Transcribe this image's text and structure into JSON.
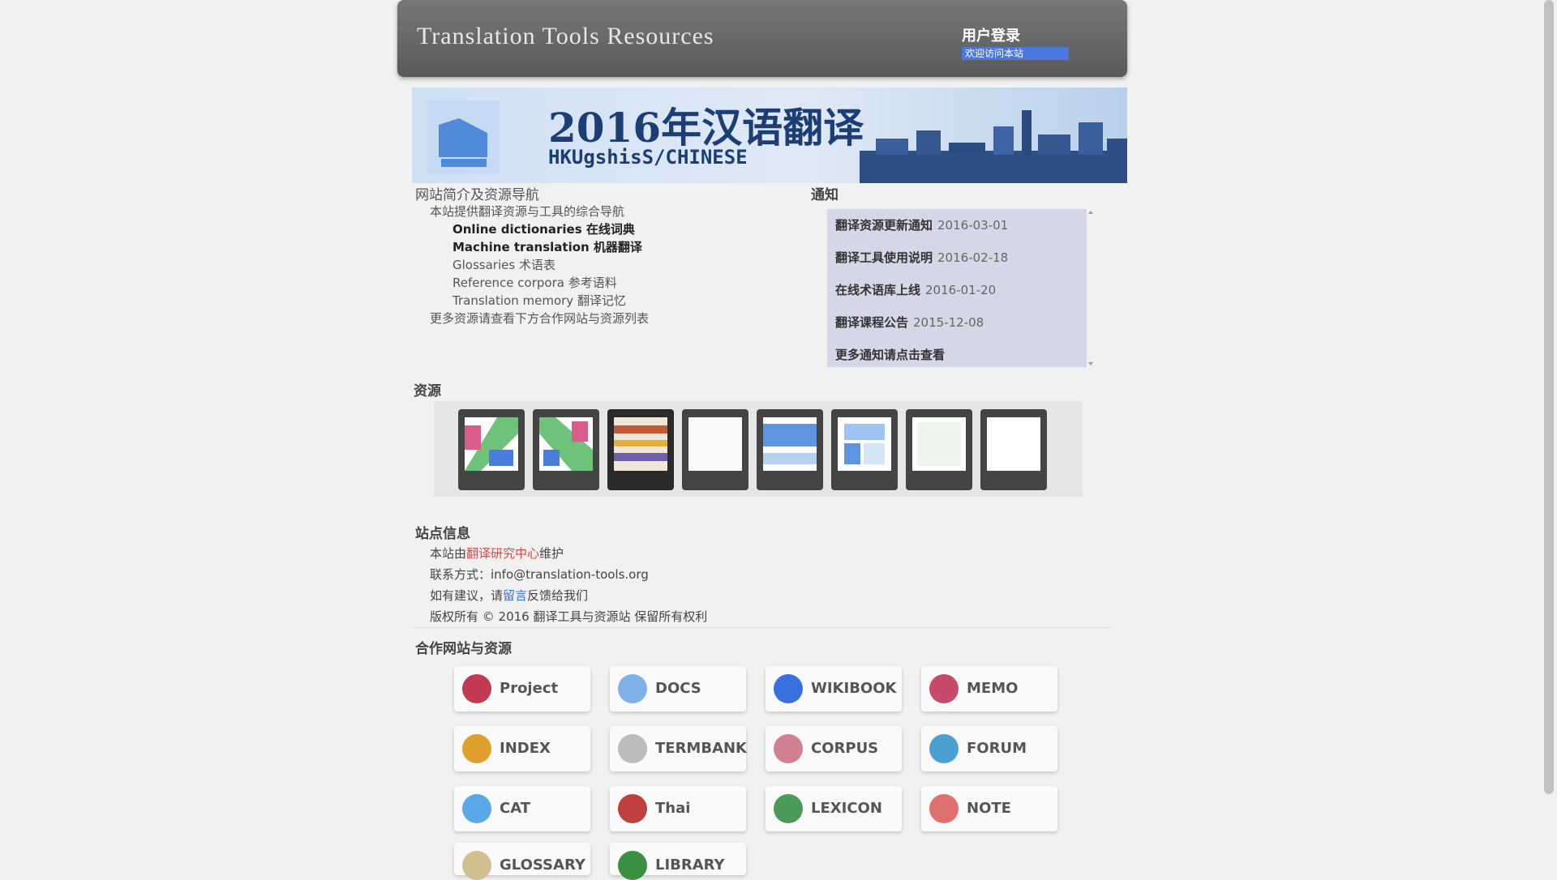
{
  "header": {
    "title": "Translation Tools Resources",
    "login_label": "用户登录",
    "login_sub": "欢迎访问本站"
  },
  "banner": {
    "title": "2016年汉语翻译",
    "subtitle": "HKUgshisS/CHINESE"
  },
  "intro": {
    "heading": "网站简介及资源导航",
    "lines": [
      "本站提供翻译资源与工具的综合导航",
      "Online dictionaries 在线词典",
      "Machine translation 机器翻译",
      "Glossaries 术语表",
      "Reference corpora 参考语料",
      "Translation memory 翻译记忆",
      "更多资源请查看下方合作网站与资源列表"
    ]
  },
  "notice": {
    "heading": "通知",
    "items": [
      {
        "title": "翻译资源更新通知",
        "date": "2016-03-01"
      },
      {
        "title": "翻译工具使用说明",
        "date": "2016-02-18"
      },
      {
        "title": "在线术语库上线",
        "date": "2016-01-20"
      },
      {
        "title": "翻译课程公告",
        "date": "2015-12-08"
      },
      {
        "title": "更多通知请点击查看",
        "date": ""
      }
    ]
  },
  "carousel": {
    "heading": "资源"
  },
  "info": {
    "heading": "站点信息",
    "lines": [
      {
        "pre": "本站由",
        "highlight": "翻译研究中心",
        "post": "维护"
      },
      {
        "pre": "联系方式：info@translation-tools.org",
        "highlight": "",
        "post": ""
      },
      {
        "pre": "如有建议，请",
        "highlight": "留言",
        "post": "反馈给我们"
      },
      {
        "pre": "版权所有 © 2016 翻译工具与资源站 保留所有权利",
        "highlight": "",
        "post": ""
      }
    ]
  },
  "partners": {
    "heading": "合作网站与资源",
    "items": [
      {
        "name": "Project",
        "color": "#c23a52"
      },
      {
        "name": "DOCS",
        "color": "#7fb0e8"
      },
      {
        "name": "WIKIBOOK",
        "color": "#3a6fe0"
      },
      {
        "name": "MEMO",
        "color": "#c84a6a"
      },
      {
        "name": "INDEX",
        "color": "#e0a030"
      },
      {
        "name": "TERMBANK",
        "color": "#bbbbbb"
      },
      {
        "name": "CORPUS",
        "color": "#d08090"
      },
      {
        "name": "FORUM",
        "color": "#4aa0d0"
      },
      {
        "name": "CAT",
        "color": "#5aa8e8"
      },
      {
        "name": "Thai",
        "color": "#c04040"
      },
      {
        "name": "LEXICON",
        "color": "#4a9a5a"
      },
      {
        "name": "NOTE",
        "color": "#e07070"
      },
      {
        "name": "GLOSSARY",
        "color": "#d0c090"
      },
      {
        "name": "LIBRARY",
        "color": "#3a9040"
      }
    ]
  }
}
